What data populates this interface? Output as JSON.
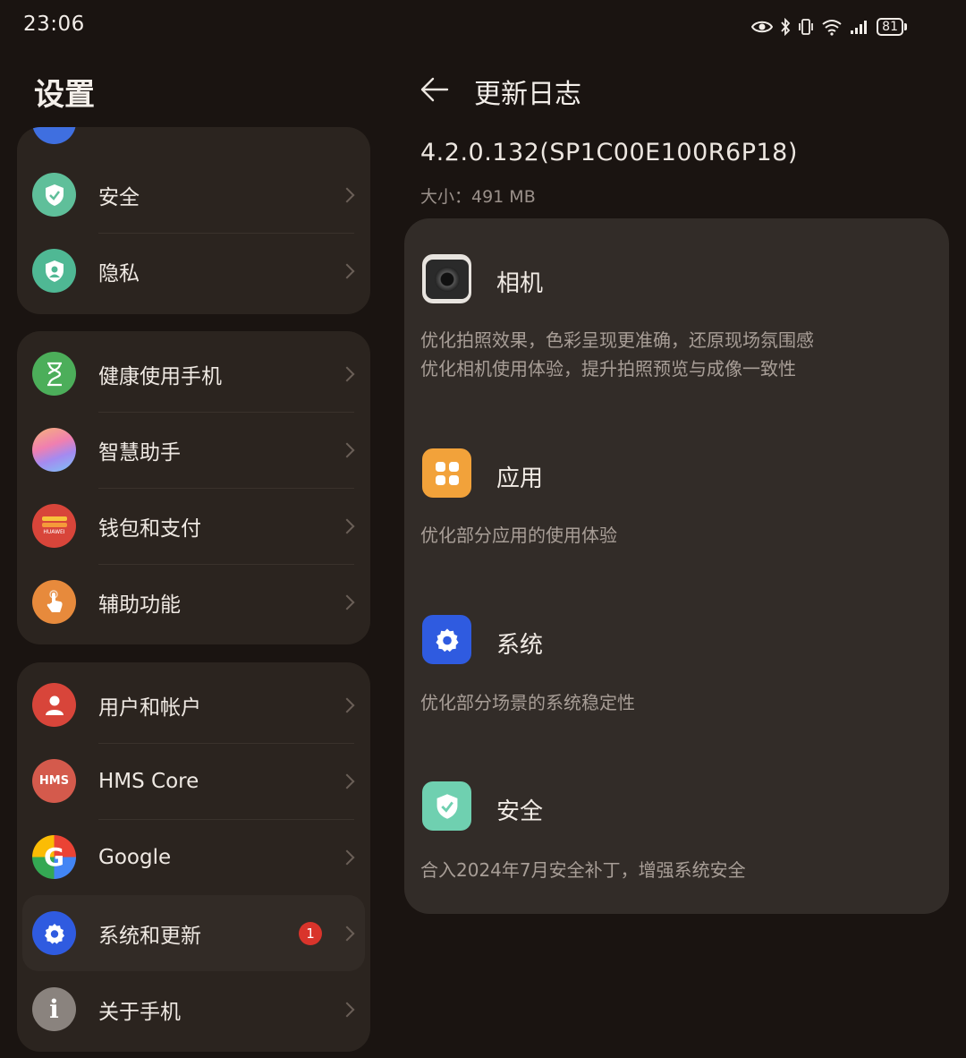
{
  "status_bar": {
    "time": "23:06",
    "battery": "81"
  },
  "left": {
    "title": "设置",
    "group1": [
      {
        "label": "安全",
        "icon": "shield-icon"
      },
      {
        "label": "隐私",
        "icon": "privacy-icon"
      }
    ],
    "group2": [
      {
        "label": "健康使用手机",
        "icon": "hourglass-icon"
      },
      {
        "label": "智慧助手",
        "icon": "assistant-icon"
      },
      {
        "label": "钱包和支付",
        "icon": "wallet-icon",
        "brand": "HUAWEI"
      },
      {
        "label": "辅助功能",
        "icon": "hand-icon"
      }
    ],
    "group3": [
      {
        "label": "用户和帐户",
        "icon": "user-icon"
      },
      {
        "label": "HMS Core",
        "icon": "hms-icon",
        "icon_text": "HMS"
      },
      {
        "label": "Google",
        "icon": "google-icon",
        "icon_text": "G"
      },
      {
        "label": "系统和更新",
        "icon": "gear-icon",
        "badge": "1"
      },
      {
        "label": "关于手机",
        "icon": "info-icon",
        "icon_text": "i"
      }
    ]
  },
  "right": {
    "title": "更新日志",
    "version": "4.2.0.132(SP1C00E100R6P18)",
    "size": "大小：491 MB",
    "sections": [
      {
        "title": "相机",
        "icon": "camera-icon",
        "desc": [
          "优化拍照效果，色彩呈现更准确，还原现场氛围感",
          "优化相机使用体验，提升拍照预览与成像一致性"
        ]
      },
      {
        "title": "应用",
        "icon": "apps-icon",
        "desc": [
          "优化部分应用的使用体验"
        ]
      },
      {
        "title": "系统",
        "icon": "gear-icon",
        "desc": [
          "优化部分场景的系统稳定性"
        ]
      },
      {
        "title": "安全",
        "icon": "shield-icon",
        "desc": [
          "合入2024年7月安全补丁，增强系统安全"
        ]
      }
    ]
  },
  "colors": {
    "background": "#1a1411",
    "card": "#2b241f",
    "log_card": "#322c28",
    "badge": "#d9342b",
    "system_blue": "#2f5be0",
    "security_teal": "#6fd0b0",
    "apps_orange": "#f2a23a"
  }
}
